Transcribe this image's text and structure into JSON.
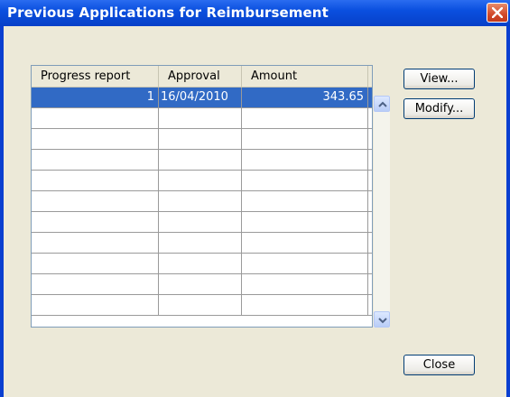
{
  "window": {
    "title": "Previous Applications for Reimbursement"
  },
  "table": {
    "columns": [
      "Progress report",
      "Approval",
      "Amount"
    ],
    "rows": [
      {
        "progress_report": "1",
        "approval": "16/04/2010",
        "amount": "343.65"
      }
    ],
    "empty_row_count": 10
  },
  "buttons": {
    "view": "View...",
    "modify": "Modify...",
    "close": "Close"
  },
  "colors": {
    "selection": "#316ac5",
    "title_bar": "#0a4fdf",
    "dialog_bg": "#ece9d8"
  }
}
